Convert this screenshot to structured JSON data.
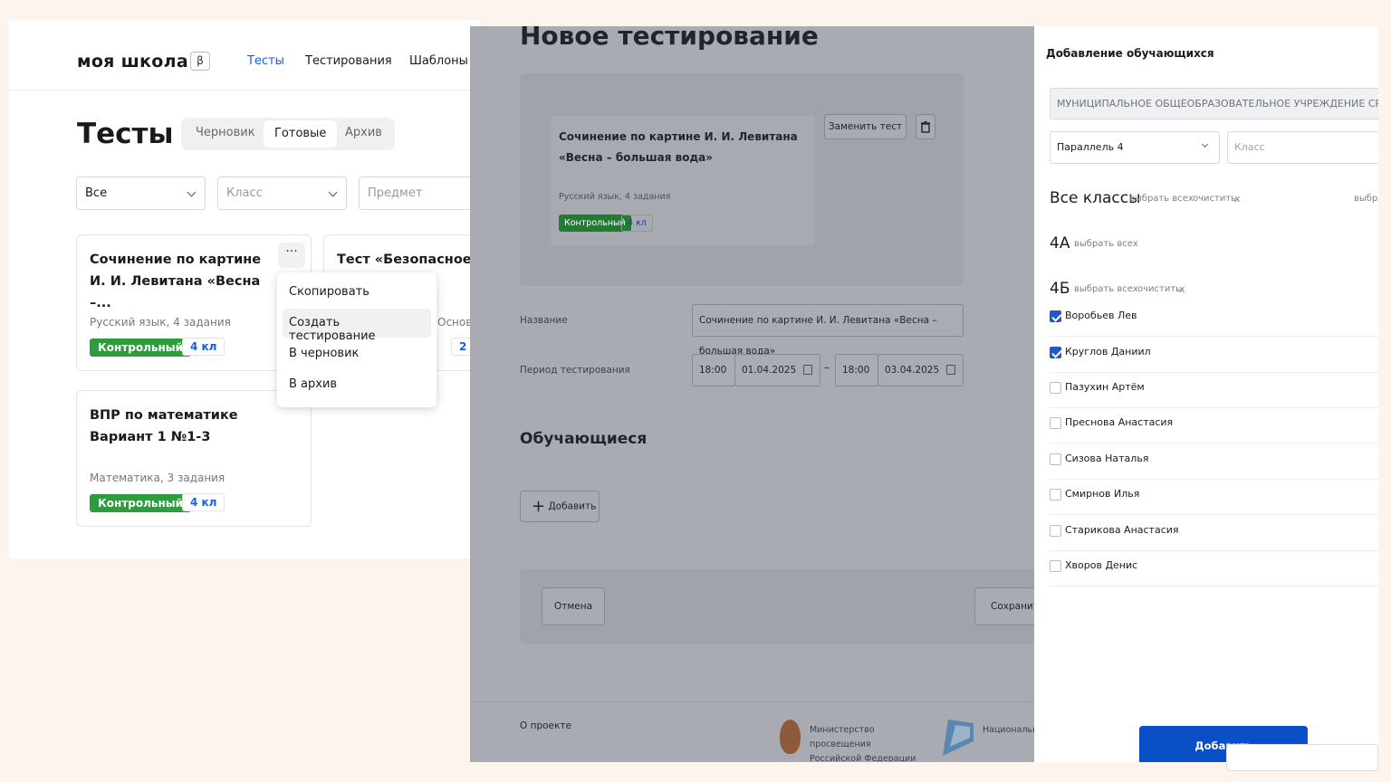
{
  "left": {
    "logo": "моя школа",
    "beta": "β",
    "nav": [
      "Тесты",
      "Тестирования",
      "Шаблоны"
    ],
    "page_title": "Тесты",
    "segments": [
      "Черновик",
      "Готовые",
      "Архив"
    ],
    "filters": {
      "all": "Все",
      "class_placeholder": "Класс",
      "subject_placeholder": "Предмет"
    },
    "cards": [
      {
        "title": "Сочинение по картине И. И. Левитана «Весна –...",
        "meta": "Русский язык, 4 задания",
        "type": "Контрольный",
        "grade": "4 кл"
      },
      {
        "title": "Тест «Безопасное ... замер",
        "meta": "Основ",
        "type": "",
        "grade": "2 к"
      },
      {
        "title": "ВПР по математике Вариант 1 №1-3",
        "meta": "Математика, 3 задания",
        "type": "Контрольный",
        "grade": "4 кл"
      }
    ],
    "dots": "···",
    "context_menu": [
      "Скопировать",
      "Создать тестирование",
      "В черновик",
      "В архив"
    ]
  },
  "middle": {
    "title": "Новое тестирование",
    "test_card": {
      "title": "Сочинение по картине И. И. Левитана «Весна – большая вода»",
      "meta": "Русский язык, 4 задания",
      "type": "Контрольный",
      "grade": "4 кл"
    },
    "replace_button": "Заменить тест",
    "trash_icon": "trash-icon",
    "name_label": "Название",
    "name_value": "Сочинение по картине И. И. Левитана «Весна – большая вода»",
    "period_label": "Период тестирования",
    "period": {
      "start_time": "18:00",
      "start_date": "01.04.2025",
      "dash": "–",
      "end_time": "18:00",
      "end_date": "03.04.2025"
    },
    "students_heading": "Обучающиеся",
    "add_button": "Добавить",
    "add_icon": "+",
    "cancel_button": "Отмена",
    "save_button": "Сохранить",
    "footer": {
      "about": "О проекте",
      "ministry": "Министерство просвещения Российской Федерации",
      "project": "Национальный «Образование»"
    }
  },
  "right": {
    "title": "Добавление обучающихся",
    "school": "МУНИЦИПАЛЬНОЕ ОБЩЕОБРАЗОВАТЕЛЬНОЕ УЧРЕЖДЕНИЕ СРЕДНЯЯ ШК...",
    "parallel": "Параллель 4",
    "class_placeholder": "Класс",
    "all_classes": {
      "label": "Все классы",
      "select_all": "выбрать всех",
      "clear": "очистить",
      "x": "x",
      "select_all_cut": "выбра"
    },
    "class_4a": {
      "label": "4А",
      "select_all": "выбрать всех"
    },
    "class_4b": {
      "label": "4Б",
      "select_all": "выбрать всех",
      "clear": "очистить",
      "x": "x"
    },
    "students": [
      {
        "name": "Воробьев Лев",
        "checked": true
      },
      {
        "name": "Круглов Даниил",
        "checked": true
      },
      {
        "name": "Пазухин Артём",
        "checked": false
      },
      {
        "name": "Преснова Анастасия",
        "checked": false
      },
      {
        "name": "Сизова Наталья",
        "checked": false
      },
      {
        "name": "Смирнов Илья",
        "checked": false
      },
      {
        "name": "Старикова Анастасия",
        "checked": false
      },
      {
        "name": "Хворов Денис",
        "checked": false
      }
    ],
    "add_button": "Добавить",
    "accent": "#0a4fc7"
  }
}
